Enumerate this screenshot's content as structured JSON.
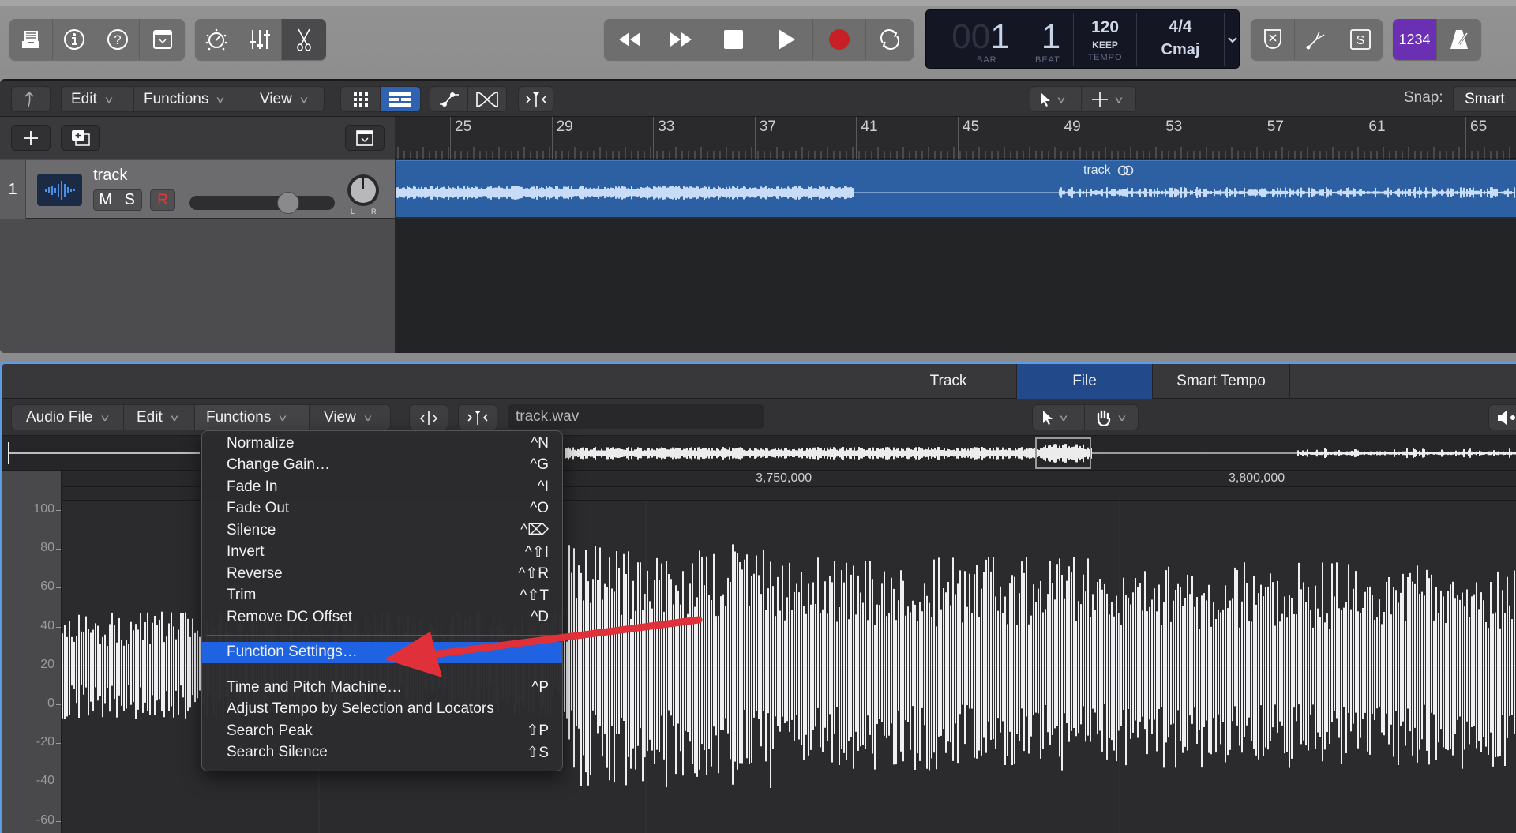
{
  "control_bar": {
    "left_group": [
      "library-icon",
      "inspector-icon",
      "quick-help-icon",
      "toolbar-icon"
    ],
    "mid_group": [
      "smart-controls-icon",
      "mixer-icon",
      "editors-icon"
    ],
    "transport": [
      "rewind-icon",
      "fast-forward-icon",
      "stop-icon",
      "play-icon",
      "record-icon",
      "cycle-icon"
    ],
    "lcd": {
      "bar_dim": "00",
      "bar": "1",
      "bar_label": "BAR",
      "beat": "1",
      "beat_label": "BEAT",
      "tempo": "120",
      "tempo_mode": "KEEP",
      "tempo_label": "TEMPO",
      "time_signature": "4/4",
      "key": "Cmaj"
    },
    "right_group": [
      "replace-icon",
      "tuner-icon",
      "solo-icon"
    ],
    "count_in_label": "1234",
    "metronome": "metronome-icon",
    "colors": {
      "record": "#c81e25",
      "count_in": "#6a2fb2",
      "accent": "#1f63e2"
    }
  },
  "tracks_toolbar": {
    "back": "back-icon",
    "edit": "Edit",
    "functions": "Functions",
    "view": "View",
    "snap_label": "Snap:",
    "snap_value": "Smart"
  },
  "ruler": {
    "bars": [
      "25",
      "29",
      "33",
      "37",
      "41",
      "45",
      "49",
      "53",
      "57",
      "61",
      "65"
    ]
  },
  "track": {
    "number": "1",
    "name": "track",
    "mute": "M",
    "solo": "S",
    "record": "R",
    "volume": 0.68,
    "pan_left": "L",
    "pan_right": "R",
    "region_name": "track"
  },
  "editor": {
    "tabs": [
      {
        "label": "Track",
        "active": false
      },
      {
        "label": "File",
        "active": true
      },
      {
        "label": "Smart Tempo",
        "active": false
      }
    ],
    "menus": {
      "audio_file": "Audio File",
      "edit": "Edit",
      "functions": "Functions",
      "view": "View"
    },
    "file_name": "track.wav",
    "sample_ruler": [
      "3,750,000",
      "3,800,000"
    ],
    "y_axis": [
      "100",
      "80",
      "60",
      "40",
      "20",
      "0",
      "-20",
      "-40",
      "-60"
    ]
  },
  "functions_menu": {
    "groups": [
      [
        {
          "label": "Normalize",
          "shortcut": "^N"
        },
        {
          "label": "Change Gain…",
          "shortcut": "^G"
        },
        {
          "label": "Fade In",
          "shortcut": "^I"
        },
        {
          "label": "Fade Out",
          "shortcut": "^O"
        },
        {
          "label": "Silence",
          "shortcut": "^⌦"
        },
        {
          "label": "Invert",
          "shortcut": "^⇧I"
        },
        {
          "label": "Reverse",
          "shortcut": "^⇧R"
        },
        {
          "label": "Trim",
          "shortcut": "^⇧T"
        },
        {
          "label": "Remove DC Offset",
          "shortcut": "^D"
        }
      ],
      [
        {
          "label": "Function Settings…",
          "shortcut": "",
          "highlighted": true
        }
      ],
      [
        {
          "label": "Time and Pitch Machine…",
          "shortcut": "^P"
        },
        {
          "label": "Adjust Tempo by Selection and Locators",
          "shortcut": ""
        },
        {
          "label": "Search Peak",
          "shortcut": "⇧P"
        },
        {
          "label": "Search Silence",
          "shortcut": "⇧S"
        }
      ]
    ]
  },
  "annotation": {
    "type": "arrow",
    "color": "#e0303a",
    "points_to": "Function Settings…"
  }
}
